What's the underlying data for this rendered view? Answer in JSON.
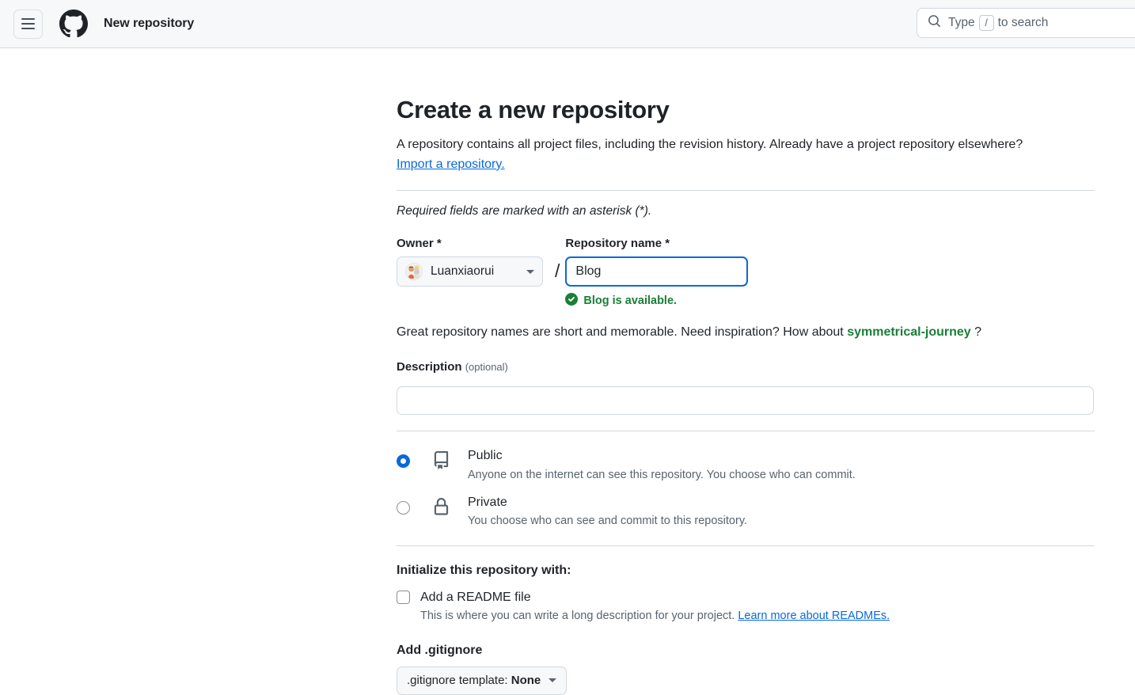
{
  "header": {
    "menu_icon": "hamburger-menu-icon",
    "logo_icon": "github-logo-icon",
    "page_title": "New repository",
    "search": {
      "icon": "search-icon",
      "prefix": "Type",
      "key": "/",
      "suffix": "to search",
      "value": ""
    }
  },
  "form": {
    "title": "Create a new repository",
    "subtitle": "A repository contains all project files, including the revision history. Already have a project repository elsewhere?",
    "import_link": "Import a repository.",
    "required_note": "Required fields are marked with an asterisk (*).",
    "owner": {
      "label": "Owner *",
      "avatar_icon": "user-avatar",
      "name": "Luanxiaorui",
      "caret_icon": "chevron-down-icon"
    },
    "separator": "/",
    "repository_name": {
      "label": "Repository name *",
      "value": "Blog",
      "placeholder": "",
      "availability_icon": "check-circle-icon",
      "availability_text": "Blog is available."
    },
    "inspiration": {
      "prefix": "Great repository names are short and memorable. Need inspiration? How about",
      "suggestion": "symmetrical-journey",
      "suffix": "?"
    },
    "description": {
      "label": "Description",
      "optional": "(optional)",
      "value": "",
      "placeholder": ""
    },
    "visibility": [
      {
        "id": "public",
        "icon": "repo-book-icon",
        "title": "Public",
        "description": "Anyone on the internet can see this repository. You choose who can commit.",
        "selected": true
      },
      {
        "id": "private",
        "icon": "lock-icon",
        "title": "Private",
        "description": "You choose who can see and commit to this repository.",
        "selected": false
      }
    ],
    "initialize": {
      "title": "Initialize this repository with:",
      "readme_label": "Add a README file",
      "readme_checked": false,
      "readme_description": "This is where you can write a long description for your project.",
      "readme_link": "Learn more about READMEs."
    },
    "gitignore": {
      "title": "Add .gitignore",
      "button_prefix": ".gitignore template:",
      "button_value": "None",
      "caret_icon": "chevron-down-icon"
    }
  },
  "colors": {
    "accent": "#0969da",
    "success": "#1a7f37",
    "border": "#d1d9e0",
    "header_bg": "#f6f8fa",
    "muted_text": "#59636e"
  }
}
